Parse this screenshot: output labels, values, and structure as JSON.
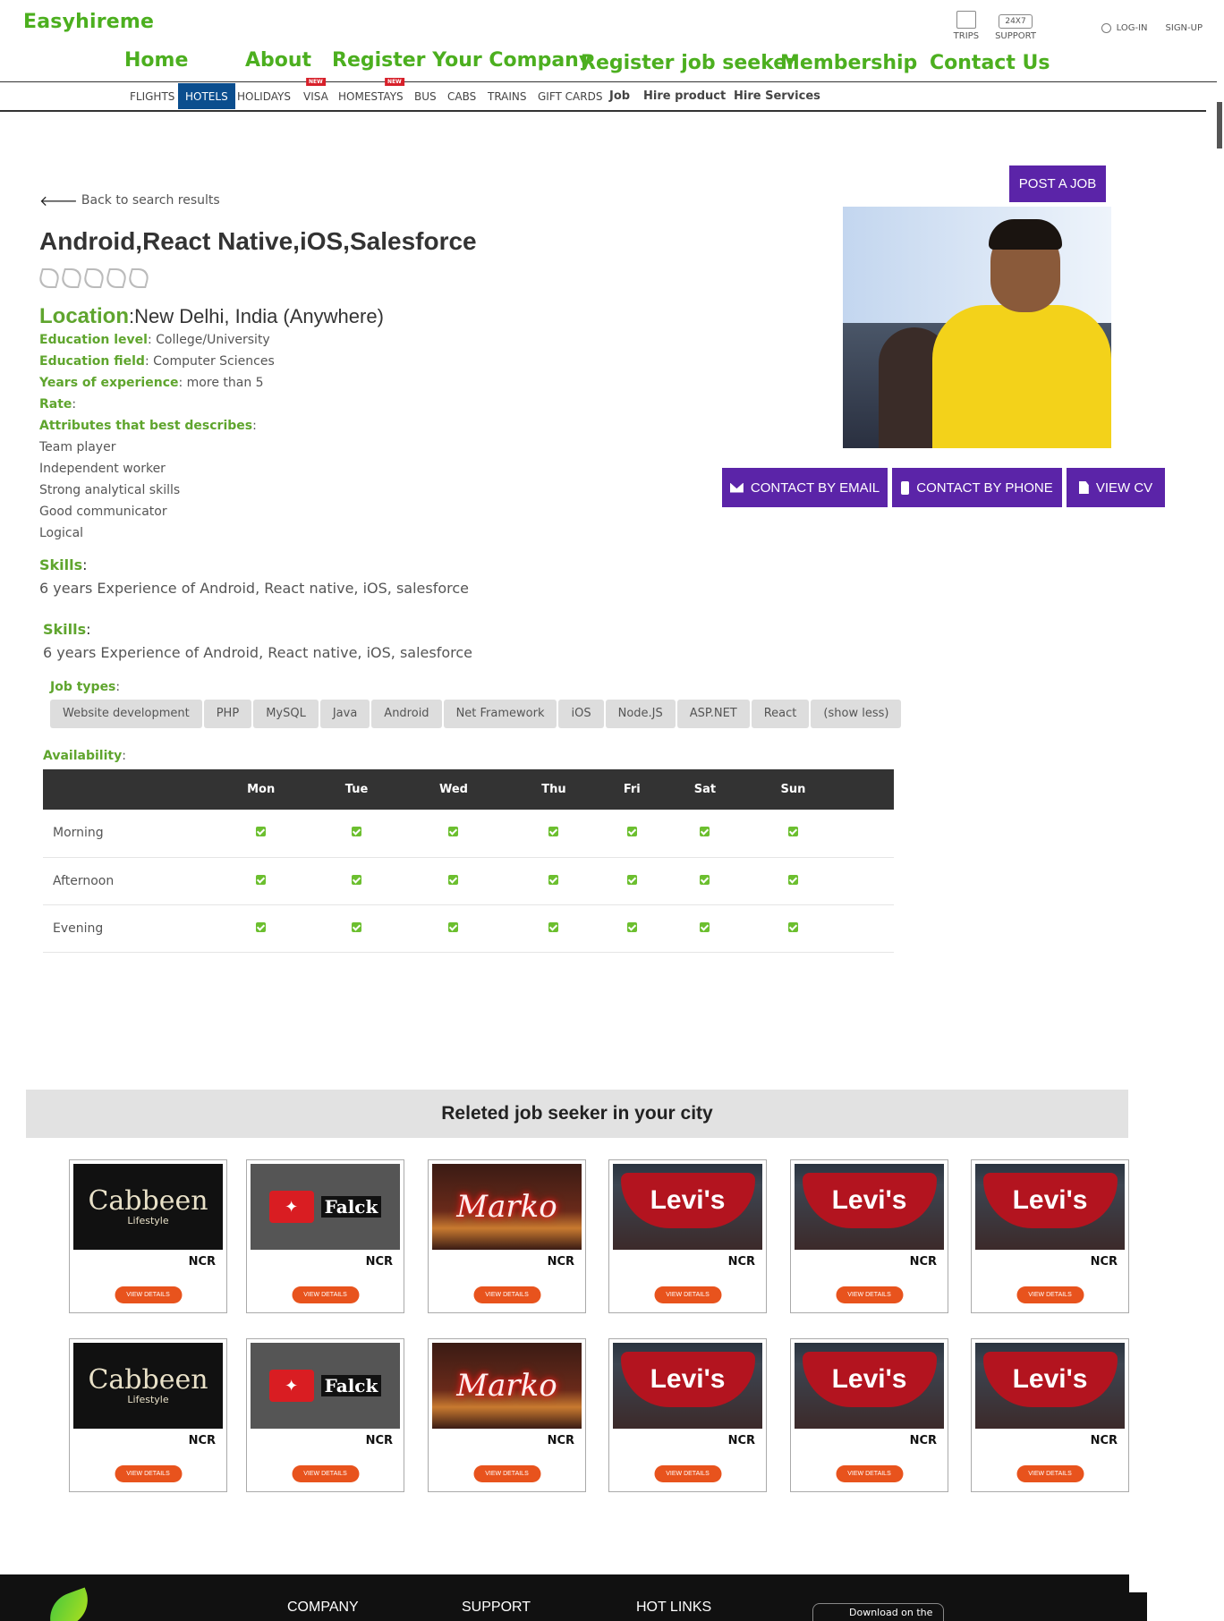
{
  "brand": "Easyhireme",
  "utils": {
    "trips": "TRIPS",
    "support_box": "24X7",
    "support": "SUPPORT",
    "login": "LOG-IN",
    "signup": "SIGN-UP"
  },
  "mainnav": [
    "Home",
    "About",
    "Register Your Company",
    "Register job seeker",
    "Membership",
    "Contact Us"
  ],
  "subnav": {
    "flights": "FLIGHTS",
    "hotels": "HOTELS",
    "holidays": "HOLIDAYS",
    "visa": "VISA",
    "homestays": "HOMESTAYS",
    "bus": "BUS",
    "cabs": "CABS",
    "trains": "TRAINS",
    "giftcards": "GIFT CARDS",
    "job": "Job",
    "hire_product": "Hire product",
    "hire_services": "Hire Services",
    "new_tag": "NEW"
  },
  "profile": {
    "post_job": "POST A JOB",
    "back": "Back to search results",
    "title": "Android,React Native,iOS,Salesforce",
    "location_label": "Location",
    "location_value": "New Delhi, India (Anywhere)",
    "edu_level_label": "Education level",
    "edu_level_value": "College/University",
    "edu_field_label": "Education field",
    "edu_field_value": "Computer Sciences",
    "years_label": "Years of experience",
    "years_value": "more than 5",
    "rate_label": "Rate",
    "attributes_label": "Attributes that best describes",
    "attributes": [
      "Team player",
      "Independent worker",
      "Strong analytical skills",
      "Good communicator",
      "Logical"
    ],
    "skills_label": "Skills",
    "skills_text": "6 years Experience of Android, React native, iOS, salesforce",
    "job_types_label": "Job types",
    "job_types": [
      "Website development",
      "PHP",
      "MySQL",
      "Java",
      "Android",
      "Net Framework",
      "iOS",
      "Node.JS",
      "ASP.NET",
      "React",
      "(show less)"
    ],
    "contact_email": "CONTACT BY EMAIL",
    "contact_phone": "CONTACT BY PHONE",
    "view_cv": "VIEW CV"
  },
  "availability": {
    "label": "Availability",
    "days": [
      "Mon",
      "Tue",
      "Wed",
      "Thu",
      "Fri",
      "Sat",
      "Sun"
    ],
    "slots": [
      "Morning",
      "Afternoon",
      "Evening"
    ]
  },
  "related": {
    "heading": "Releted  job  seeker  in your city",
    "cards": [
      {
        "brand": "Cabbeen",
        "sub": "Lifestyle",
        "city": "NCR",
        "button": "VIEW DETAILS"
      },
      {
        "brand": "Falck",
        "city": "NCR",
        "button": "VIEW DETAILS"
      },
      {
        "brand": "Marko",
        "city": "NCR",
        "button": "VIEW DETAILS"
      },
      {
        "brand": "Levi's",
        "city": "NCR",
        "button": "VIEW DETAILS"
      },
      {
        "brand": "Levi's",
        "city": "NCR",
        "button": "VIEW DETAILS"
      },
      {
        "brand": "Levi's",
        "city": "NCR",
        "button": "VIEW DETAILS"
      },
      {
        "brand": "Cabbeen",
        "sub": "Lifestyle",
        "city": "NCR",
        "button": "VIEW DETAILS"
      },
      {
        "brand": "Falck",
        "city": "NCR",
        "button": "VIEW DETAILS"
      },
      {
        "brand": "Marko",
        "city": "NCR",
        "button": "VIEW DETAILS"
      },
      {
        "brand": "Levi's",
        "city": "NCR",
        "button": "VIEW DETAILS"
      },
      {
        "brand": "Levi's",
        "city": "NCR",
        "button": "VIEW DETAILS"
      },
      {
        "brand": "Levi's",
        "city": "NCR",
        "button": "VIEW DETAILS"
      }
    ]
  },
  "footer": {
    "company": "COMPANY",
    "support": "SUPPORT",
    "hotlinks": "HOT LINKS",
    "appstore": "Download on the"
  },
  "colors": {
    "green": "#4caf1f",
    "purple": "#5b24a8",
    "navy": "#0b4e8e",
    "orange": "#e8531d"
  }
}
